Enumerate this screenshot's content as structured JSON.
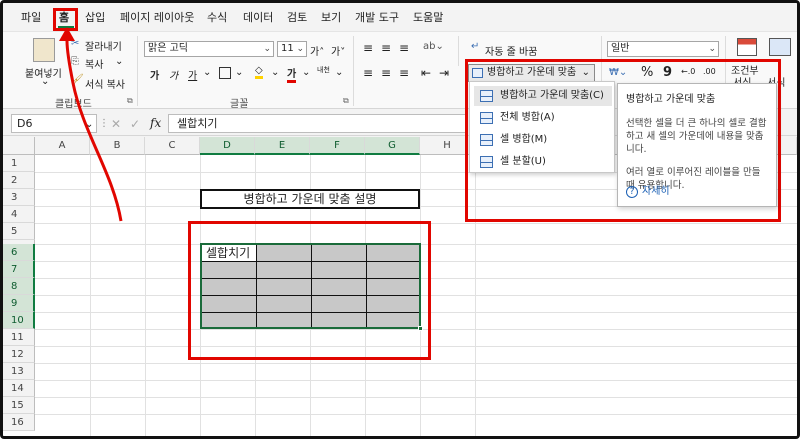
{
  "menu": {
    "items": [
      "파일",
      "홈",
      "삽입",
      "페이지 레이아웃",
      "수식",
      "데이터",
      "검토",
      "보기",
      "개발 도구",
      "도움말"
    ]
  },
  "ribbon": {
    "clipboard": {
      "paste": "붙여넣기",
      "cut": "잘라내기",
      "copy": "복사",
      "format_painter": "서식 복사",
      "group_label": "클립보드"
    },
    "font": {
      "font_name": "맑은 고딕",
      "font_size": "11",
      "bold": "가",
      "italic": "가",
      "underline": "가",
      "grow": "가˄",
      "shrink": "가˅",
      "phonetic": "내천",
      "group_label": "글꼴"
    },
    "alignment": {
      "wrap_text": "자동 줄 바꿈",
      "merge_center": "병합하고 가운데 맞춤"
    },
    "number": {
      "format": "일반",
      "percent": "%",
      "comma": "9"
    },
    "styles": {
      "conditional_line1": "조건부",
      "conditional_line2": "서식",
      "table_format_partial": "서식"
    }
  },
  "formula_bar": {
    "name_box": "D6",
    "fx": "fx",
    "value": "셀합치기"
  },
  "sheet": {
    "columns": [
      "A",
      "B",
      "C",
      "D",
      "E",
      "F",
      "G",
      "H"
    ],
    "rows": [
      "1",
      "2",
      "3",
      "4",
      "5",
      "6",
      "7",
      "8",
      "9",
      "10",
      "11",
      "12",
      "13",
      "14",
      "15",
      "16"
    ],
    "title_cell": "병합하고 가운데 맞춤 설명",
    "d6": "셀합치기"
  },
  "merge_menu": {
    "items": [
      {
        "label": "병합하고 가운데 맞춤(C)"
      },
      {
        "label": "전체 병합(A)"
      },
      {
        "label": "셀 병합(M)"
      },
      {
        "label": "셀 분할(U)"
      }
    ]
  },
  "tooltip": {
    "title": "병합하고 가운데 맞춤",
    "body1": "선택한 셀을 더 큰 하나의 셀로 결합하고 새 셀의 가운데에 내용을 맞춥니다.",
    "body2": "여러 열로 이루어진 레이블을 만들 때 유용합니다.",
    "more": "자세히"
  },
  "colors": {
    "accent_green": "#107c41",
    "highlight_red": "#e10600",
    "selection_fill": "#c8c8c8"
  }
}
